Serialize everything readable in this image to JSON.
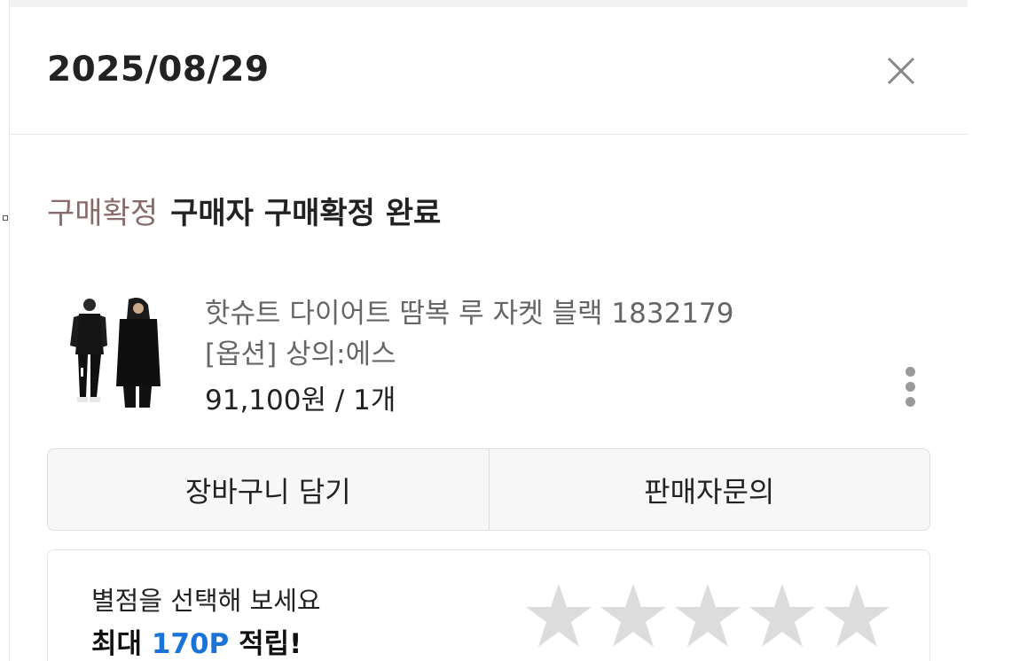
{
  "header": {
    "date": "2025/08/29"
  },
  "status": {
    "label": "구매확정",
    "text": "구매자 구매확정 완료"
  },
  "product": {
    "name": "핫슈트 다이어트 땀복 루 자켓 블랙 1832179",
    "option": "[옵션] 상의:에스",
    "price": "91,100원 / 1개"
  },
  "actions": {
    "cart_label": "장바구니 담기",
    "inquiry_label": "판매자문의"
  },
  "rating": {
    "prompt": "별점을 선택해 보세요",
    "reward_prefix": "최대 ",
    "reward_points": "170P",
    "reward_suffix": " 적립!",
    "stars_selected": 0,
    "stars_total": 5
  },
  "colors": {
    "status_label": "#8a6a6a",
    "points_accent": "#1a73d9",
    "star_empty": "#dcdcdc"
  },
  "icons": {
    "close": "close-icon",
    "more": "more-vertical-icon",
    "star": "star-icon"
  }
}
